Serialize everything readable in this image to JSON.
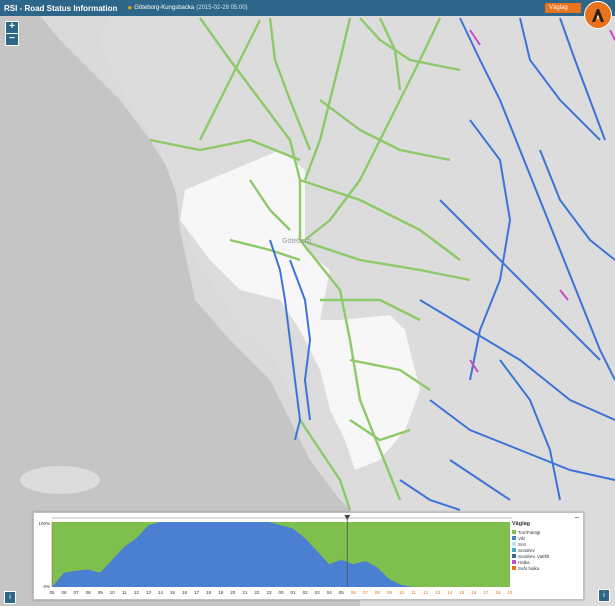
{
  "header": {
    "title": "RSI - Road Status Information",
    "location": "Göteborg-Kungsbacka",
    "date": "(2015-02-28 05:00)",
    "layer_button": "Väglag"
  },
  "controls": {
    "zoom_in": "+",
    "zoom_out": "−",
    "minimize": "−"
  },
  "map_labels": [
    "Göteborg"
  ],
  "chart_data": {
    "type": "area",
    "y_ticks": [
      "100%",
      "0%"
    ],
    "ylim": [
      0,
      100
    ],
    "x_labels": [
      "05",
      "06",
      "07",
      "08",
      "09",
      "10",
      "11",
      "12",
      "13",
      "14",
      "15",
      "16",
      "17",
      "18",
      "19",
      "20",
      "21",
      "22",
      "23",
      "00",
      "01",
      "02",
      "03",
      "04",
      "05",
      "06",
      "07",
      "08",
      "09",
      "10",
      "11",
      "12",
      "13",
      "14",
      "15",
      "16",
      "17",
      "18",
      "19"
    ],
    "forecast_start_index": 25,
    "series": [
      {
        "name": "Våt",
        "color": "#4a7fd1",
        "values": [
          0,
          22,
          25,
          27,
          22,
          42,
          62,
          75,
          95,
          100,
          100,
          100,
          100,
          100,
          100,
          100,
          100,
          100,
          100,
          95,
          90,
          75,
          55,
          35,
          42,
          35,
          40,
          30,
          12,
          3,
          0,
          0,
          0,
          0,
          0,
          0,
          0,
          0,
          0
        ]
      },
      {
        "name": "Torr/Fuktigt",
        "color": "#7fbf4d",
        "values": [
          100,
          78,
          75,
          73,
          78,
          58,
          38,
          25,
          5,
          0,
          0,
          0,
          0,
          0,
          0,
          0,
          0,
          0,
          0,
          5,
          10,
          25,
          45,
          65,
          58,
          65,
          60,
          70,
          88,
          97,
          100,
          100,
          100,
          100,
          100,
          100,
          100,
          100,
          100
        ]
      }
    ],
    "legend": {
      "title": "Väglag",
      "items": [
        {
          "label": "Torr/Fuktigt",
          "color": "#7fbf4d"
        },
        {
          "label": "Våt",
          "color": "#4a7fd1"
        },
        {
          "label": "Snö",
          "color": "#bfe3f5"
        },
        {
          "label": "Snödrev",
          "color": "#41a9c9"
        },
        {
          "label": "Snödrev, Vattfilt",
          "color": "#3c6a8c"
        },
        {
          "label": "Halka",
          "color": "#c94cc9"
        },
        {
          "label": "Svår halka",
          "color": "#e8731c"
        }
      ]
    }
  }
}
